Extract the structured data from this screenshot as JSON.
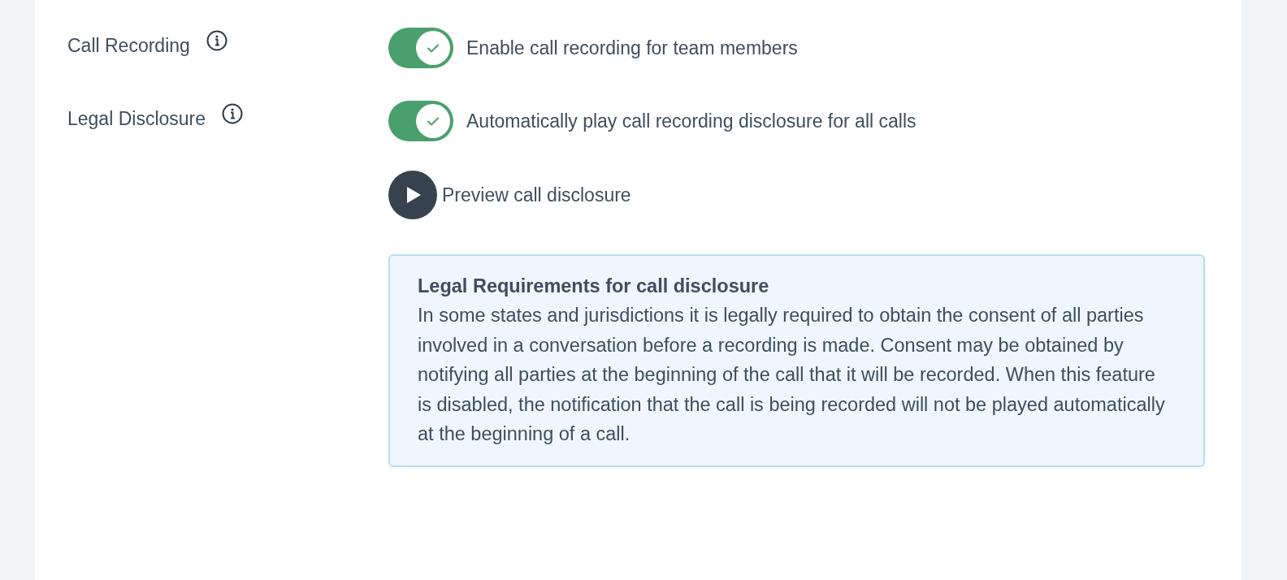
{
  "settings": [
    {
      "label": "Call Recording",
      "toggle": {
        "on": true,
        "text": "Enable call recording for team members"
      }
    },
    {
      "label": "Legal Disclosure",
      "toggle": {
        "on": true,
        "text": "Automatically play call recording disclosure for all calls"
      }
    }
  ],
  "preview": {
    "label": "Preview call disclosure"
  },
  "notice": {
    "title": "Legal Requirements for call disclosure",
    "body": "In some states and jurisdictions it is legally required to obtain the consent of all parties involved in a conversation before a recording is made. Consent may be obtained by notifying all parties at the beginning of the call that it will be recorded. When this feature is disabled, the notification that the call is being recorded will not be played automatically at the beginning of a call."
  }
}
